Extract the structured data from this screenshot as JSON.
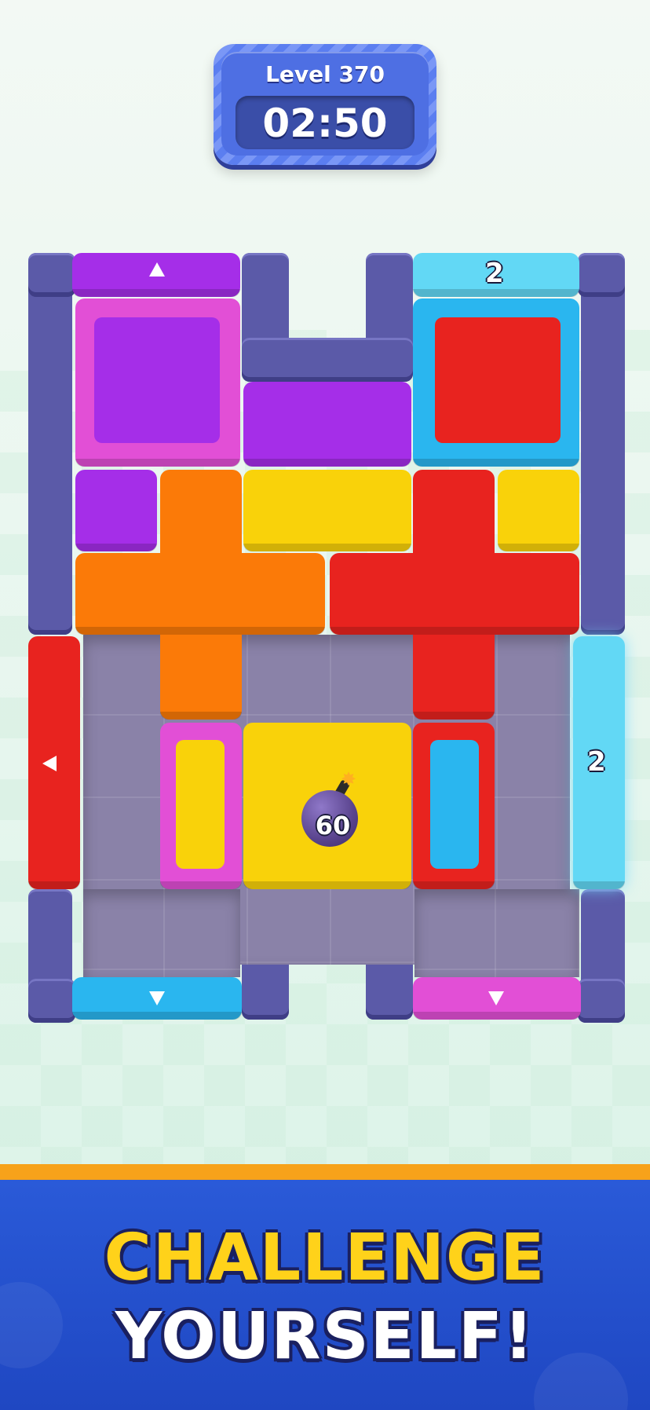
{
  "header": {
    "level_label": "Level 370",
    "timer": "02:50"
  },
  "board": {
    "exits": [
      {
        "id": "top-left-exit",
        "color": "#a22ee8",
        "marker": "up-arrow-icon"
      },
      {
        "id": "top-right-exit",
        "color": "#62d8f5",
        "marker_text": "2"
      },
      {
        "id": "left-exit",
        "color": "#e62b2b",
        "marker": "left-arrow-icon"
      },
      {
        "id": "right-exit",
        "color": "#62d8f5",
        "marker_text": "2"
      },
      {
        "id": "bottom-left-exit",
        "color": "#29b6f0",
        "marker": "down-arrow-icon"
      },
      {
        "id": "bottom-right-exit",
        "color": "#ee4fd0",
        "marker": "down-arrow-icon"
      }
    ],
    "bomb": {
      "count": "60",
      "icon": "bomb-icon"
    },
    "colors": {
      "purple": "#a52ee8",
      "magenta": "#e24fd6",
      "red": "#e8231f",
      "cyan": "#2ab6ef",
      "yellow": "#f9d20a",
      "orange": "#fb7a08",
      "wall": "#5b5aa8"
    }
  },
  "banner": {
    "line1": "CHALLENGE",
    "line2": "YOURSELF!"
  }
}
